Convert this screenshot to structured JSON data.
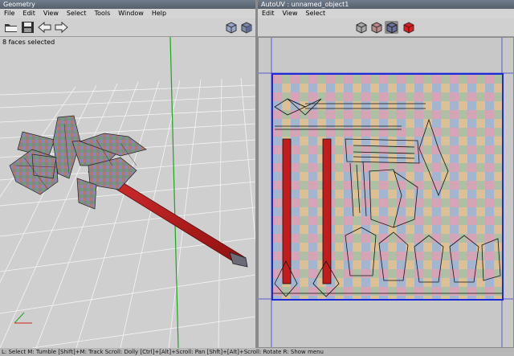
{
  "left_window": {
    "title": "Geometry",
    "menu": [
      "File",
      "Edit",
      "View",
      "Select",
      "Tools",
      "Window",
      "Help"
    ],
    "status": "8 faces selected",
    "toolbar_icons": [
      "open-folder-icon",
      "save-icon",
      "back-arrow-icon",
      "forward-arrow-icon",
      "wire-cube-icon",
      "shaded-cube-icon"
    ]
  },
  "right_window": {
    "title": "AutoUV : unnamed_object1",
    "menu": [
      "Edit",
      "View",
      "Select"
    ],
    "toolbar_icons": [
      "wire-cube-icon",
      "textured-cube-icon",
      "selected-cube-icon",
      "red-cube-icon"
    ]
  },
  "hint_bar": "L: Select   M: Tumble   [Shift]+M: Track   Scroll: Dolly   [Ctrl]+[Alt]+Scroll: Pan   [Shft]+[Alt]+Scroll: Rotate   R: Show menu",
  "colors": {
    "titlebar": "#5e6a78",
    "uv_border": "#1b2bd8",
    "handle": "#b11818",
    "mesh": "#7b7b8b"
  }
}
